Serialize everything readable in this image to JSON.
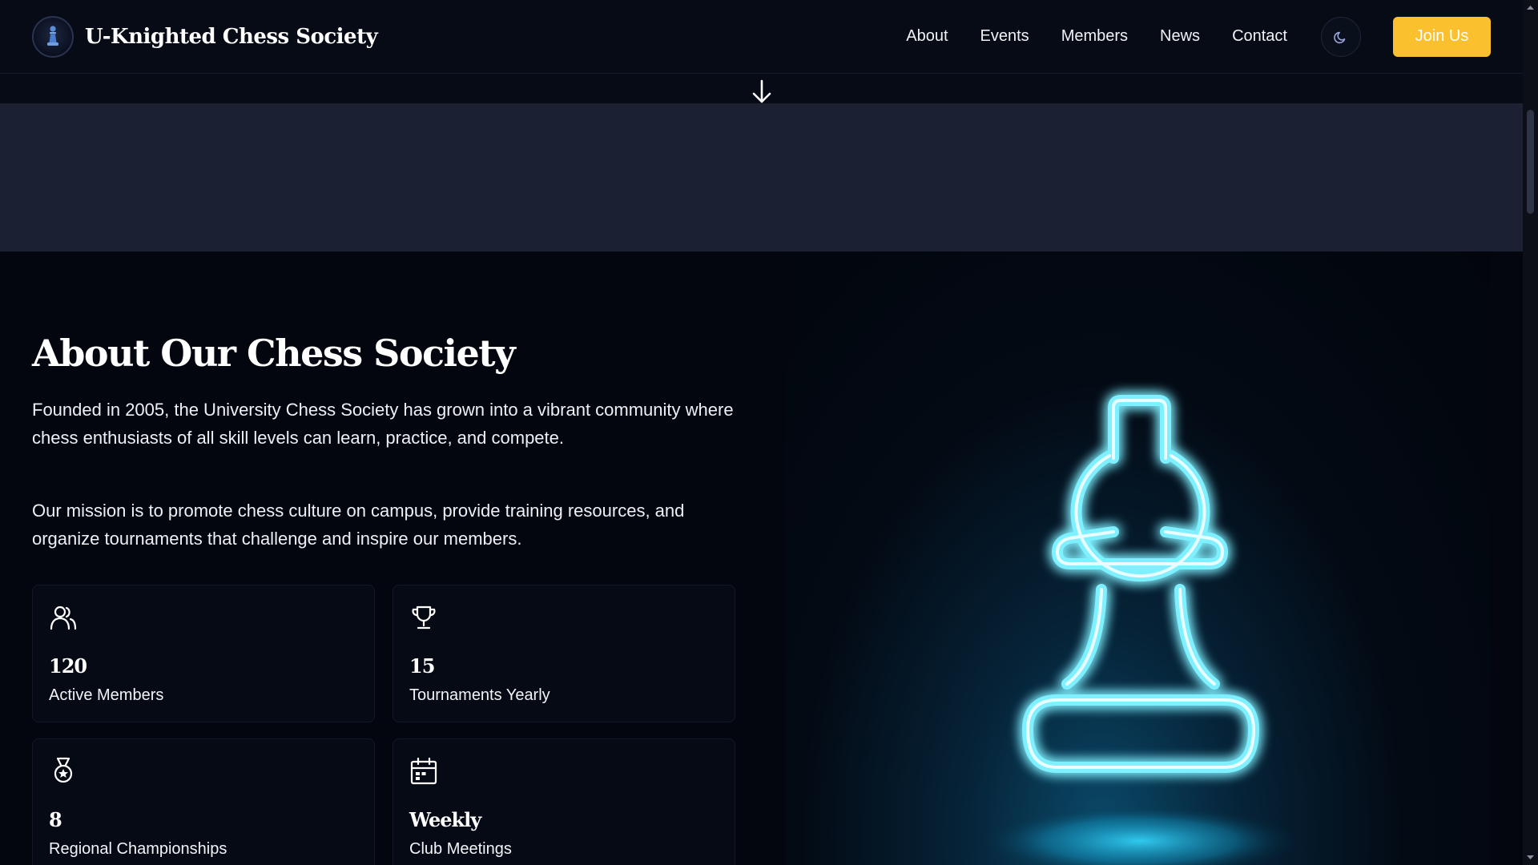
{
  "header": {
    "brand_title": "U-Knighted Chess Society",
    "nav": [
      "About",
      "Events",
      "Members",
      "News",
      "Contact"
    ],
    "join_label": "Join Us"
  },
  "about": {
    "title": "About Our Chess Society",
    "paragraphs": [
      "Founded in 2005, the University Chess Society has grown into a vibrant community where chess enthusiasts of all skill levels can learn, practice, and compete.",
      "Our mission is to promote chess culture on campus, provide training resources, and organize tournaments that challenge and inspire our members."
    ],
    "stats": [
      {
        "icon": "users-icon",
        "value": "120",
        "label": "Active Members"
      },
      {
        "icon": "trophy-icon",
        "value": "15",
        "label": "Tournaments Yearly"
      },
      {
        "icon": "medal-icon",
        "value": "8",
        "label": "Regional Championships"
      },
      {
        "icon": "calendar-icon",
        "value": "Weekly",
        "label": "Club Meetings"
      }
    ]
  },
  "colors": {
    "accent": "#fbc02d",
    "background": "#03060f",
    "neon": "#5fe7ff"
  }
}
